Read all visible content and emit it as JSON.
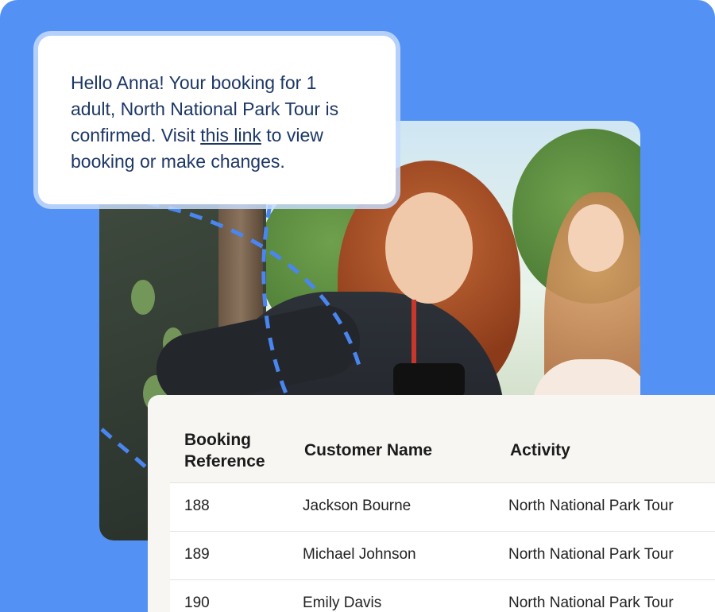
{
  "message": {
    "text_before": "Hello Anna! Your booking for 1 adult, North National Park Tour is confirmed. Visit ",
    "link_text": "this link",
    "text_after": " to view booking or make changes."
  },
  "table": {
    "headers": {
      "booking_reference_line1": "Booking",
      "booking_reference_line2": "Reference",
      "customer_name": "Customer Name",
      "activity": "Activity"
    },
    "rows": [
      {
        "ref": "188",
        "name": "Jackson Bourne",
        "activity": "North National Park Tour"
      },
      {
        "ref": "189",
        "name": "Michael Johnson",
        "activity": "North National Park Tour"
      },
      {
        "ref": "190",
        "name": "Emily Davis",
        "activity": "North National Park Tour"
      }
    ]
  },
  "colors": {
    "background": "#5391f5",
    "message_text": "#1d3766",
    "table_header_bg": "#f7f6f3",
    "dashed_path": "#4a86f0"
  }
}
